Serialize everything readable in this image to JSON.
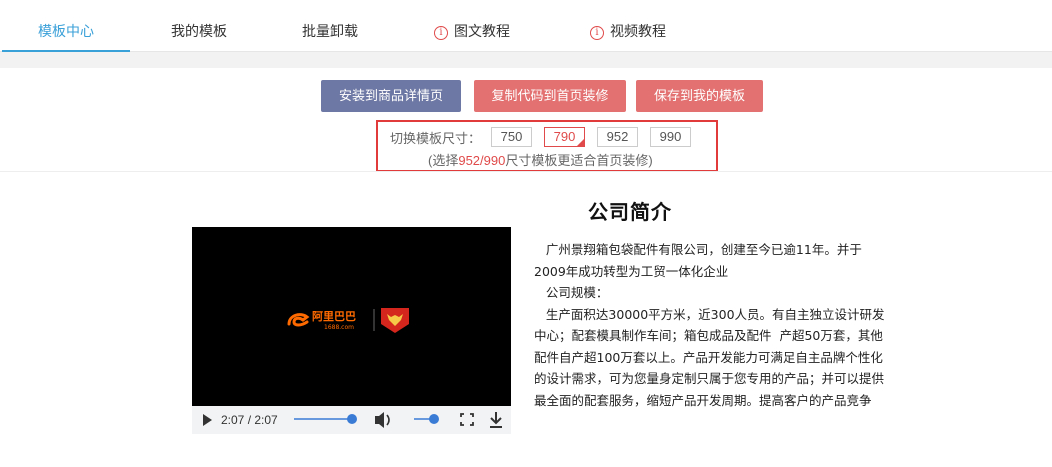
{
  "tabs": [
    {
      "label": "模板中心",
      "active": true,
      "icon": null
    },
    {
      "label": "我的模板",
      "active": false,
      "icon": null
    },
    {
      "label": "批量卸载",
      "active": false,
      "icon": null
    },
    {
      "label": "图文教程",
      "active": false,
      "icon": "info-icon"
    },
    {
      "label": "视频教程",
      "active": false,
      "icon": "info-icon"
    }
  ],
  "actions": {
    "install_label": "安装到商品详情页",
    "copy_label": "复制代码到首页装修",
    "save_label": "保存到我的模板"
  },
  "size_selector": {
    "label": "切换模板尺寸：",
    "options": [
      "750",
      "790",
      "952",
      "990"
    ],
    "selected": "790",
    "hint_prefix": "(选择",
    "hint_highlight": "952/990",
    "hint_suffix": "尺寸模板更适合首页装修)"
  },
  "video": {
    "logo_text": "阿里巴巴",
    "logo_sub": "1688.com",
    "time": "2:07 / 2:07",
    "progress": 1.0,
    "volume": 1.0
  },
  "company": {
    "title": "公司简介",
    "lines": [
      "   广州景翔箱包袋配件有限公司，创建至今已逾11年。并于",
      "2009年成功转型为工贸一体化企业",
      "   公司规模：",
      "   生产面积达30000平方米，近300人员。有自主独立设计研发",
      "中心；配套模具制作车间；箱包成品及配件  产超50万套，其他",
      "配件自产超100万套以上。产品开发能力可满足自主品牌个性化",
      "的设计需求，可为您量身定制只属于您专用的产品；并可以提供",
      "最全面的配套服务，缩短产品开发周期。提高客户的产品竞争"
    ]
  },
  "colors": {
    "accent_blue": "#3aa0d8",
    "button_blue": "#6e78a4",
    "button_red": "#e37171",
    "highlight_red": "#e04a4a"
  }
}
